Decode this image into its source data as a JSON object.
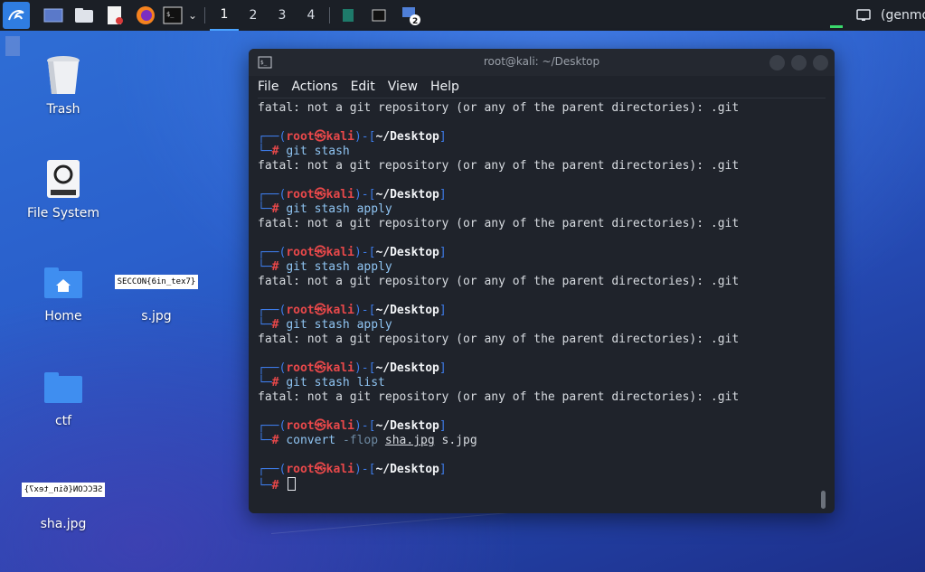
{
  "taskbar": {
    "workspaces": [
      "1",
      "2",
      "3",
      "4"
    ],
    "active_workspace": "1",
    "notification_badge": "2",
    "right_text": "(genmo"
  },
  "desktop": {
    "icons": [
      {
        "label": "Trash",
        "icon": "trash-icon"
      },
      {
        "label": "File System",
        "icon": "drive-icon"
      },
      {
        "label": "Home",
        "icon": "home-folder-icon"
      },
      {
        "label": "s.jpg",
        "icon": "image-file-icon",
        "thumbnail_text": "SECCON{6in_tex7}"
      },
      {
        "label": "ctf",
        "icon": "folder-icon"
      },
      {
        "label": "sha.jpg",
        "icon": "image-file-icon",
        "thumbnail_text": "SECCON{6in_tex7}",
        "mirrored": true
      }
    ]
  },
  "terminal": {
    "title": "root@kali: ~/Desktop",
    "menu": [
      "File",
      "Actions",
      "Edit",
      "View",
      "Help"
    ],
    "prompt": {
      "user": "root",
      "host": "kali",
      "path": "~/Desktop",
      "symbol": "#"
    },
    "error_text": "fatal: not a git repository (or any of the parent directories): .git",
    "blocks": [
      {
        "command": "git stash",
        "output": "fatal: not a git repository (or any of the parent directories): .git"
      },
      {
        "command": "git stash apply",
        "output": "fatal: not a git repository (or any of the parent directories): .git"
      },
      {
        "command": "git stash apply",
        "output": "fatal: not a git repository (or any of the parent directories): .git"
      },
      {
        "command": "git stash apply",
        "output": "fatal: not a git repository (or any of the parent directories): .git"
      },
      {
        "command": "git stash list",
        "output": "fatal: not a git repository (or any of the parent directories): .git"
      }
    ],
    "convert_cmd": {
      "name": "convert",
      "flag": "-flop",
      "arg1": "sha.jpg",
      "arg2": "s.jpg"
    }
  },
  "colors": {
    "prompt_frame": "#3d7be8",
    "prompt_user": "#e8484a",
    "command": "#8fc4f2",
    "active_workspace_underline": "#4aa3ff"
  }
}
